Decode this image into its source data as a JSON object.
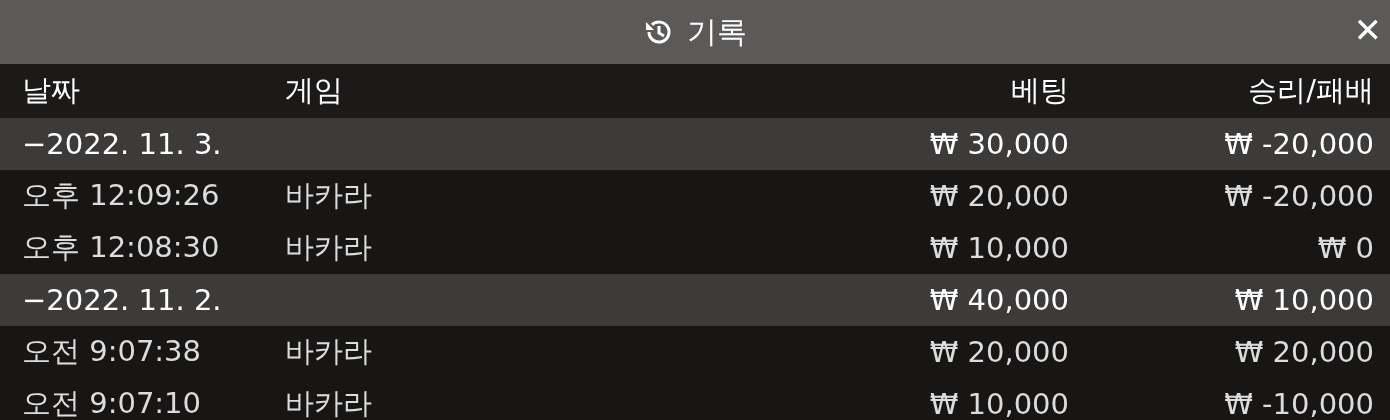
{
  "header": {
    "title": "기록",
    "close": "✕"
  },
  "columns": [
    "날짜",
    "게임",
    "베팅",
    "승리/패배"
  ],
  "rows": [
    {
      "kind": "date",
      "date": "−2022. 11. 3.",
      "bet": "₩ 30,000",
      "result": "₩ -20,000"
    },
    {
      "kind": "bet",
      "date": "오후 12:09:26",
      "game": "바카라",
      "bet": "₩ 20,000",
      "result": "₩ -20,000"
    },
    {
      "kind": "bet",
      "date": "오후 12:08:30",
      "game": "바카라",
      "bet": "₩ 10,000",
      "result": "₩ 0"
    },
    {
      "kind": "date",
      "date": "−2022. 11. 2.",
      "bet": "₩ 40,000",
      "result": "₩ 10,000"
    },
    {
      "kind": "bet",
      "date": "오전 9:07:38",
      "game": "바카라",
      "bet": "₩ 20,000",
      "result": "₩ 20,000"
    },
    {
      "kind": "bet",
      "date": "오전 9:07:10",
      "game": "바카라",
      "bet": "₩ 10,000",
      "result": "₩ -10,000"
    }
  ]
}
